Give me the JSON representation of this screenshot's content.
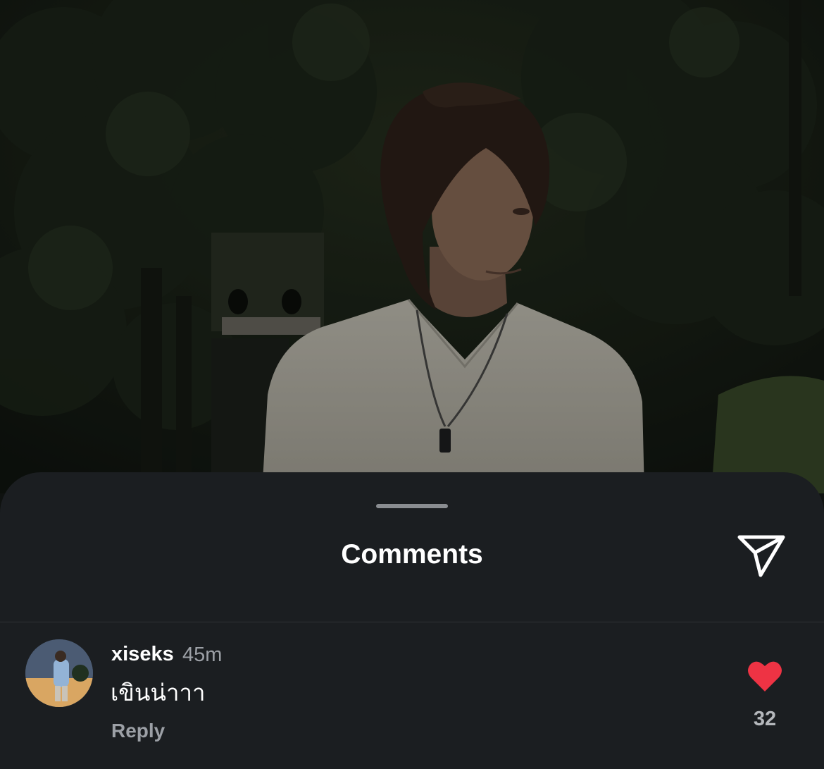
{
  "sheet": {
    "title": "Comments",
    "send_icon": "paper-plane-icon"
  },
  "comment": {
    "username": "xiseks",
    "time": "45m",
    "text": "เขินน่าาา",
    "reply_label": "Reply",
    "like_count": "32",
    "like_icon": "heart-filled-icon",
    "like_color": "#ee3344",
    "liked": true
  }
}
